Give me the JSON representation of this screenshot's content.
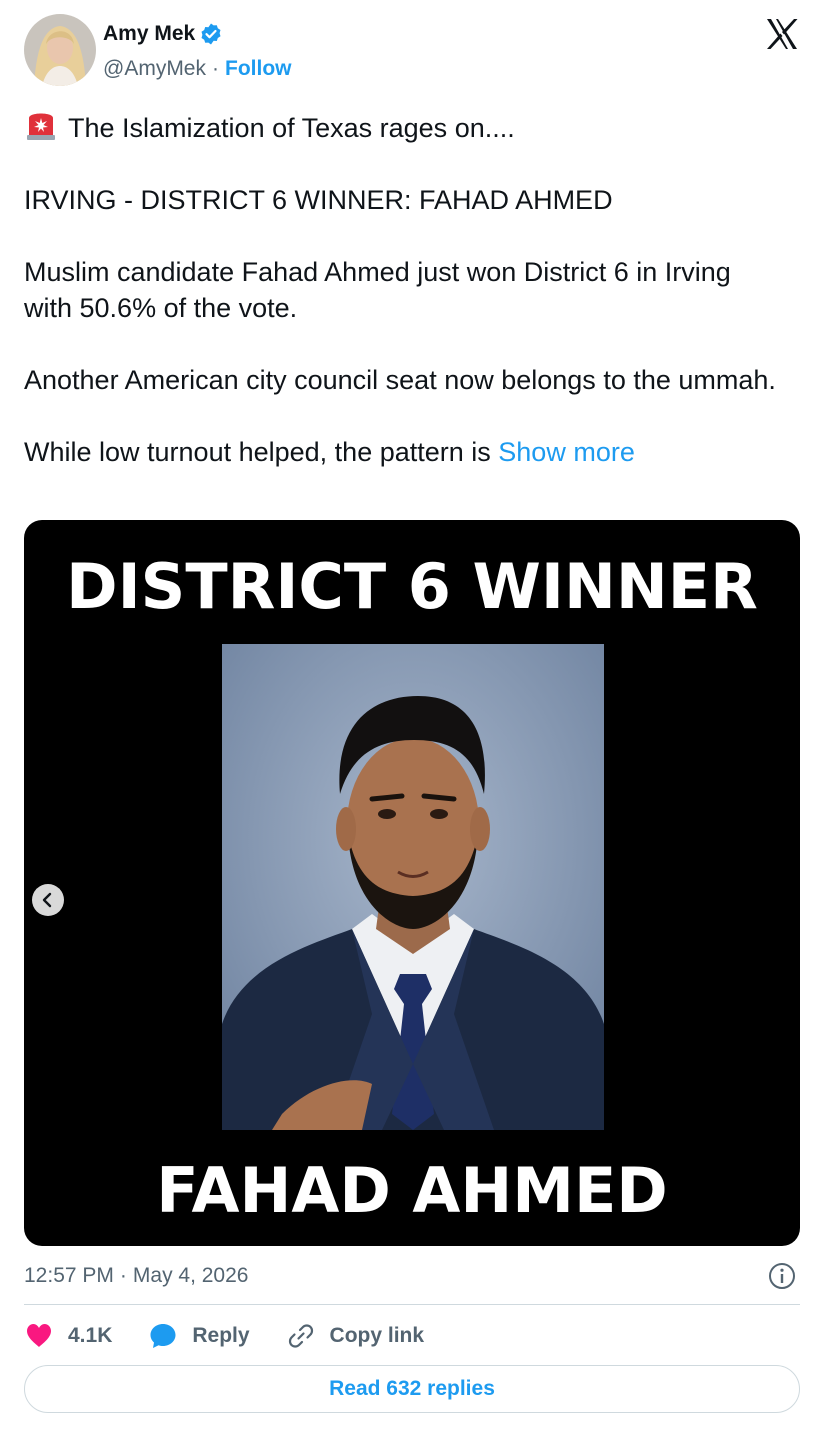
{
  "author": {
    "display_name": "Amy Mek",
    "handle": "@AmyMek",
    "separator": "·",
    "follow_label": "Follow",
    "verified_color": "#1d9bf0"
  },
  "tweet": {
    "line1": "The Islamization of Texas rages on....",
    "line1_icon": "siren-emoji-icon",
    "line2": "IRVING - DISTRICT 6 WINNER: FAHAD AHMED",
    "line3": "Muslim candidate Fahad Ahmed just won District 6 in Irving with 50.6% of the vote.",
    "line4": "Another American city council seat now belongs to the ummah.",
    "line5": "While low turnout helped, the pattern is",
    "show_more": "Show more"
  },
  "media": {
    "top_text": "DISTRICT 6 WINNER",
    "bottom_text": "FAHAD AHMED",
    "prev_icon": "chevron-left-icon"
  },
  "meta": {
    "time": "12:57 PM",
    "separator": "·",
    "date": "May 4, 2026",
    "info_icon": "info-icon"
  },
  "actions": {
    "likes": "4.1K",
    "reply_label": "Reply",
    "copy_link_label": "Copy link",
    "like_color": "#f91880",
    "reply_color": "#1d9bf0"
  },
  "replies_button": "Read 632 replies",
  "colors": {
    "link": "#1d9bf0",
    "secondary_text": "#536471",
    "border": "#cfd9de"
  }
}
